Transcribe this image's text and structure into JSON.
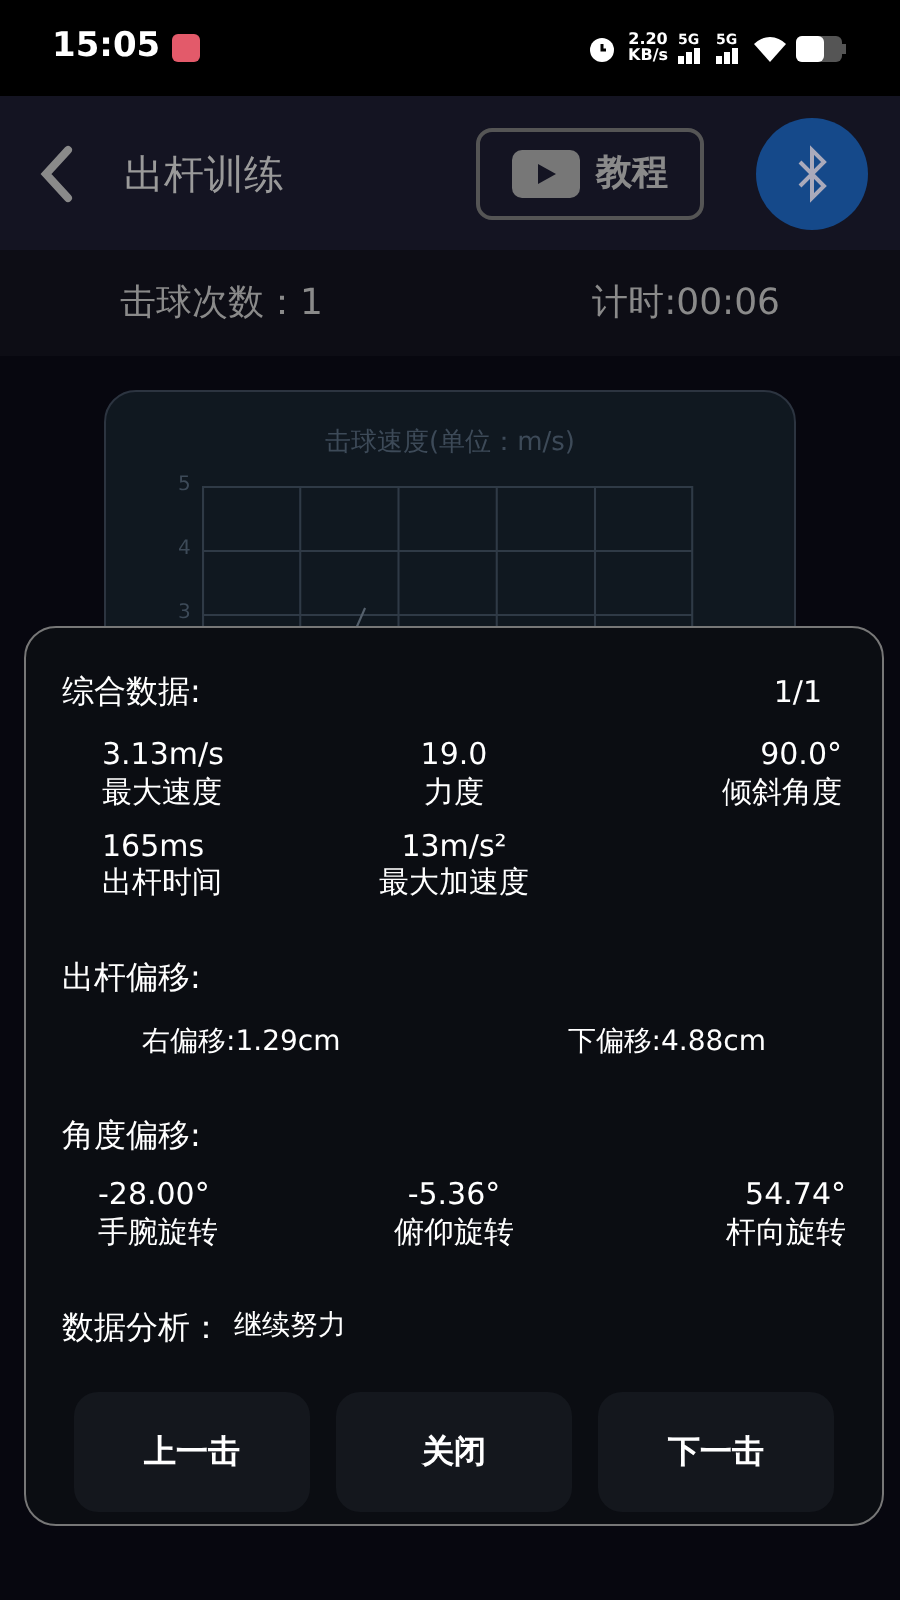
{
  "status_bar": {
    "time": "15:05",
    "net_speed_value": "2.20",
    "net_speed_unit": "KB/s",
    "signal_labels": [
      "5G",
      "5G"
    ]
  },
  "header": {
    "title": "出杆训练",
    "tutorial_button": "教程"
  },
  "stats": {
    "hits": "击球次数：1",
    "timer": "计时:00:06"
  },
  "speed_card": {
    "title": "击球速度(单位：m/s)",
    "y_ticks": [
      "5",
      "4",
      "3"
    ]
  },
  "dialog": {
    "summary_title": "综合数据:",
    "page": "1/1",
    "summary": [
      {
        "value": "3.13m/s",
        "label": "最大速度"
      },
      {
        "value": "19.0",
        "label": "力度"
      },
      {
        "value": "90.0°",
        "label": "倾斜角度"
      },
      {
        "value": "165ms",
        "label": "出杆时间"
      },
      {
        "value": "13m/s²",
        "label": "最大加速度"
      }
    ],
    "offset_title": "出杆偏移:",
    "offsets": [
      "右偏移:1.29cm",
      "下偏移:4.88cm"
    ],
    "angle_title": "角度偏移:",
    "angles": [
      {
        "value": "-28.00°",
        "label": "手腕旋转"
      },
      {
        "value": "-5.36°",
        "label": "俯仰旋转"
      },
      {
        "value": "54.74°",
        "label": "杆向旋转"
      }
    ],
    "analysis_label": "数据分析：",
    "analysis_value": "继续努力",
    "buttons": [
      "上一击",
      "关闭",
      "下一击"
    ]
  }
}
